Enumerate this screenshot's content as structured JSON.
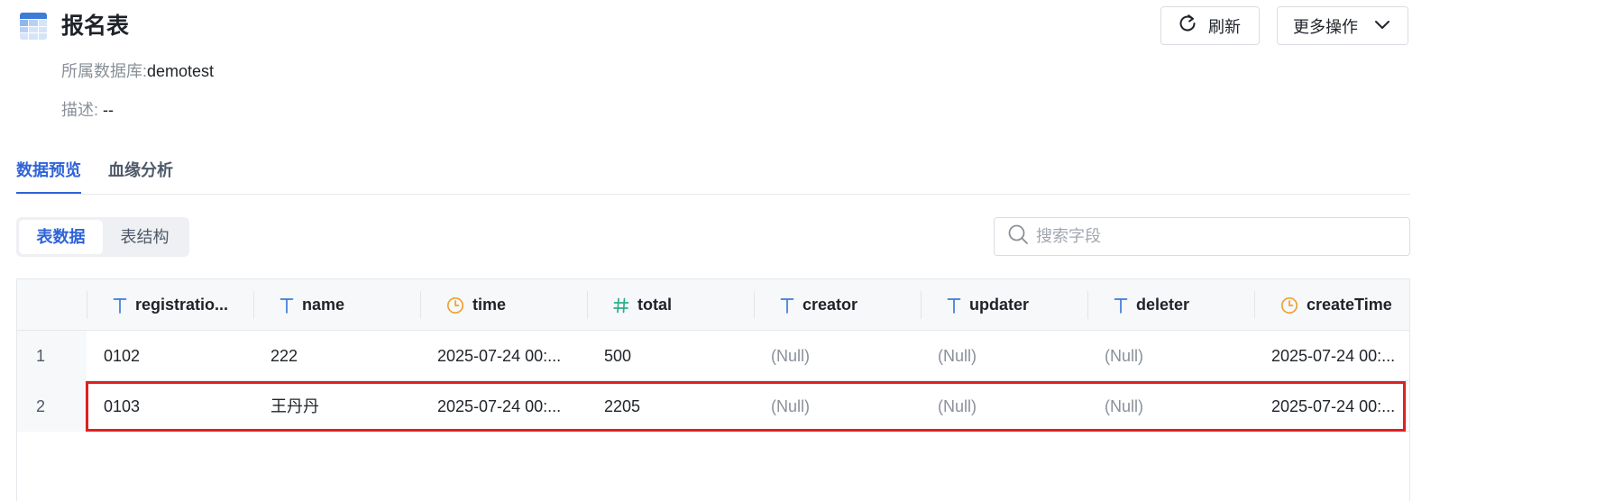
{
  "header": {
    "title": "报名表",
    "database_label": "所属数据库:",
    "database_value": "demotest",
    "description_label": "描述:",
    "description_value": "--",
    "refresh_label": "刷新",
    "more_label": "更多操作"
  },
  "tabs": [
    {
      "label": "数据预览",
      "active": true
    },
    {
      "label": "血缘分析",
      "active": false
    }
  ],
  "segment": [
    {
      "label": "表数据",
      "active": true
    },
    {
      "label": "表结构",
      "active": false
    }
  ],
  "search": {
    "placeholder": "搜索字段"
  },
  "table": {
    "columns": [
      {
        "name": "registratio...",
        "type_icon": "text-type-icon"
      },
      {
        "name": "name",
        "type_icon": "text-type-icon"
      },
      {
        "name": "time",
        "type_icon": "clock-icon"
      },
      {
        "name": "total",
        "type_icon": "hash-icon"
      },
      {
        "name": "creator",
        "type_icon": "text-type-icon"
      },
      {
        "name": "updater",
        "type_icon": "text-type-icon"
      },
      {
        "name": "deleter",
        "type_icon": "text-type-icon"
      },
      {
        "name": "createTime",
        "type_icon": "clock-icon"
      }
    ],
    "rows": [
      {
        "index": "1",
        "cells": [
          "0102",
          "222",
          "2025-07-24 00:...",
          "500",
          "(Null)",
          "(Null)",
          "(Null)",
          "2025-07-24 00:..."
        ]
      },
      {
        "index": "2",
        "cells": [
          "0103",
          "王丹丹",
          "2025-07-24 00:...",
          "2205",
          "(Null)",
          "(Null)",
          "(Null)",
          "2025-07-24 00:..."
        ]
      }
    ],
    "highlighted_row_index": "2"
  },
  "colors": {
    "accent": "#2f64d8",
    "highlight_border": "#e02020",
    "text_icon": "#3d7bd9",
    "clock_icon": "#f0a030",
    "hash_icon": "#2bae8c"
  }
}
